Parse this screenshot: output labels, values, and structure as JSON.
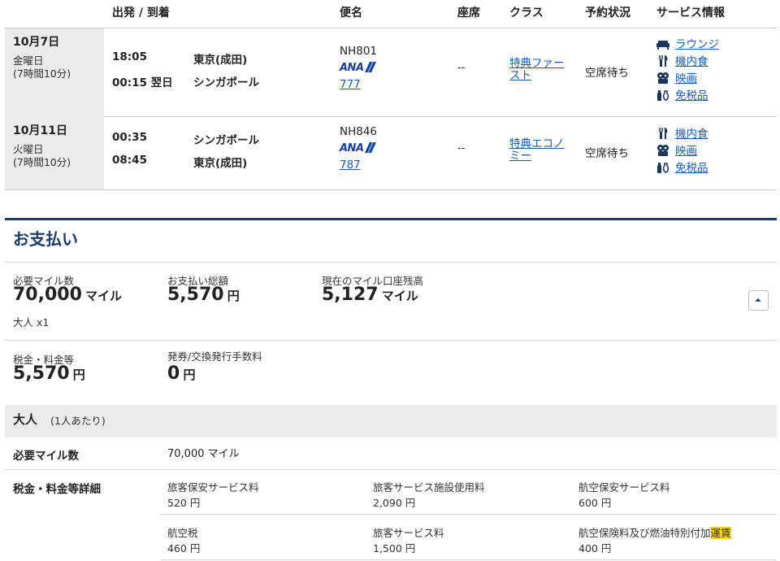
{
  "table_header": {
    "departure_arrival": "出発 / 到着",
    "flight": "便名",
    "seat": "座席",
    "class": "クラス",
    "status": "予約状況",
    "services": "サービス情報"
  },
  "flights": [
    {
      "date": "10月7日",
      "weekday": "金曜日",
      "duration": "(7時間10分)",
      "dep_time": "18:05",
      "dep_place": "東京(成田)",
      "arr_time": "00:15 翌日",
      "arr_place": "シンガポール",
      "flight_no": "NH801",
      "airline": "ANA",
      "aircraft": "777",
      "seat": "--",
      "class_line1": "特典ファー",
      "class_line2": "スト",
      "status": "空席待ち",
      "services": [
        "ラウンジ",
        "機内食",
        "映画",
        "免税品"
      ]
    },
    {
      "date": "10月11日",
      "weekday": "火曜日",
      "duration": "(7時間10分)",
      "dep_time": "00:35",
      "dep_place": "シンガポール",
      "arr_time": "08:45",
      "arr_place": "東京(成田)",
      "flight_no": "NH846",
      "airline": "ANA",
      "aircraft": "787",
      "seat": "--",
      "class_line1": "特典エコノ",
      "class_line2": "ミー",
      "status": "空席待ち",
      "services": [
        "機内食",
        "映画",
        "免税品"
      ]
    }
  ],
  "payment": {
    "title": "お支払い",
    "required_miles_label": "必要マイル数",
    "required_miles": "70,000",
    "miles_unit": "マイル",
    "passenger_count": "大人 x1",
    "total_label": "お支払い総額",
    "total": "5,570",
    "yen_unit": "円",
    "balance_label": "現在のマイル口座残高",
    "balance": "5,127",
    "tax_label": "税金・料金等",
    "tax": "5,570",
    "fee_label": "発券/交換発行手数料",
    "fee": "0"
  },
  "adult": {
    "title": "大人",
    "per_person": "(1人あたり)",
    "miles_label": "必要マイル数",
    "miles_value": "70,000 マイル",
    "tax_detail_label": "税金・料金等詳細",
    "fees": [
      {
        "name": "旅客保安サービス料",
        "value": "520 円"
      },
      {
        "name": "旅客サービス施設使用料",
        "value": "2,090 円"
      },
      {
        "name": "航空保安サービス料",
        "value": "600 円"
      },
      {
        "name": "航空税",
        "value": "460 円"
      },
      {
        "name": "旅客サービス料",
        "value": "1,500 円"
      },
      {
        "name_prefix": "航空保険料及び燃油特別付加",
        "name_highlight": "運賃",
        "value": "400 円"
      }
    ]
  },
  "colors": {
    "link": "#1b5cae",
    "section_line": "#1c3d66",
    "highlight": "#ffd700",
    "date_bg": "#ebebeb"
  }
}
